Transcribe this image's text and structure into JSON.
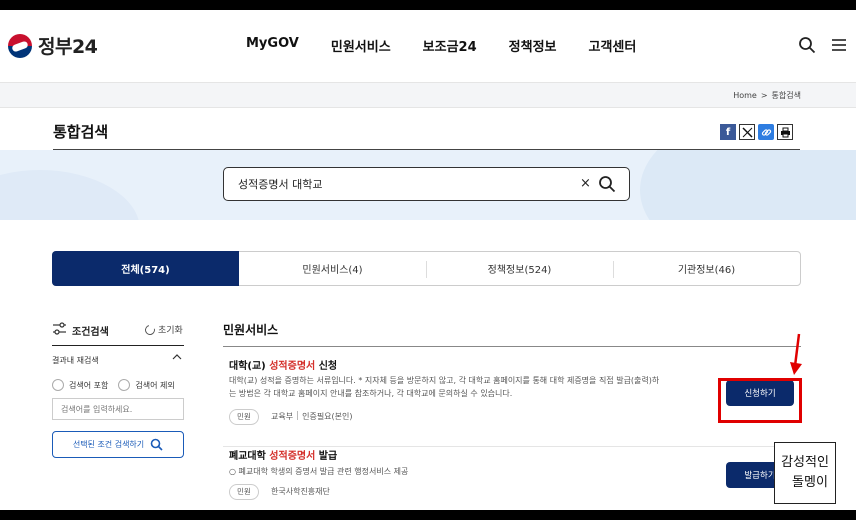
{
  "header": {
    "logo_text": "정부24",
    "nav": [
      "MyGOV",
      "민원서비스",
      "보조금24",
      "정책정보",
      "고객센터"
    ]
  },
  "breadcrumb": {
    "home": "Home",
    "separator": ">",
    "current": "통합검색"
  },
  "page_title": "통합검색",
  "share_icons": [
    "facebook-icon",
    "x-icon",
    "link-icon",
    "print-icon"
  ],
  "search": {
    "value": "성적증명서 대학교",
    "clear_label": "×"
  },
  "tabs": [
    {
      "label": "전체(574)",
      "active": true
    },
    {
      "label": "민원서비스(4)",
      "active": false
    },
    {
      "label": "정책정보(524)",
      "active": false
    },
    {
      "label": "기관정보(46)",
      "active": false
    }
  ],
  "filter": {
    "title": "조건검색",
    "reset_label": "초기화",
    "resubsearch_label": "결과내 재검색",
    "include_label": "검색어 포함",
    "exclude_label": "검색어 제외",
    "keyword_placeholder": "검색어를 입력하세요.",
    "apply_label": "선택된 조건 검색하기"
  },
  "results": {
    "section_title": "민원서비스",
    "items": [
      {
        "title_prefix": "대학(교) ",
        "title_highlight": "성적증명서",
        "title_suffix": " 신청",
        "desc_line1": "대학(교) 성적을 증명하는 서류입니다. * 지자체 등을 방문하지 않고, 각 대학교 홈페이지를 통해 대학 제증명을 직접 발급(출력)하",
        "desc_line2": "는 방법은 각 대학교 홈페이지 안내를 참조하거나, 각 대학교에 문의하실 수 있습니다.",
        "tag": "민원",
        "org": "교육부",
        "auth": "인증필요(본인)",
        "button": "신청하기"
      },
      {
        "title_prefix": "폐교대학 ",
        "title_highlight": "성적증명서",
        "title_suffix": " 발급",
        "desc_line1": "○ 폐교대학 학생의 증명서 발급 관련 행정서비스 제공",
        "tag": "민원",
        "org": "한국사학진흥재단",
        "button": "발급하기"
      }
    ]
  },
  "accent_colors": {
    "navy": "#0b2a6b",
    "highlight": "#d4302b",
    "annotation_red": "#e00000"
  },
  "watermark": {
    "line1": "감성적인",
    "line2": "돌멩이"
  }
}
